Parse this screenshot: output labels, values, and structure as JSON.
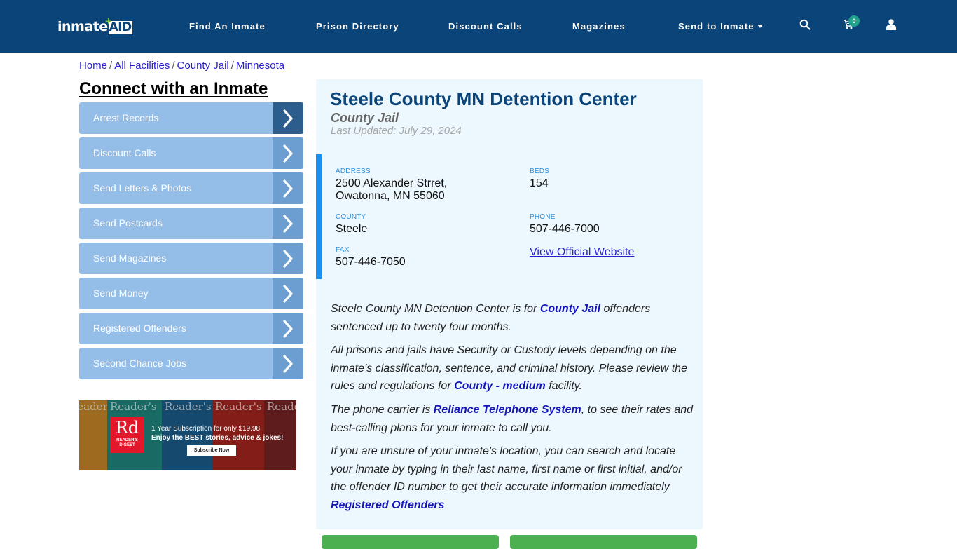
{
  "header": {
    "logo": {
      "text": "inmate",
      "accent": "AID",
      "plus": "+"
    },
    "nav": [
      {
        "label": "Find An Inmate"
      },
      {
        "label": "Prison Directory"
      },
      {
        "label": "Discount Calls"
      },
      {
        "label": "Magazines"
      },
      {
        "label": "Send to Inmate",
        "has_dropdown": true
      }
    ],
    "icons": {
      "search": "search-icon",
      "cart": "cart-icon",
      "user": "user-icon"
    },
    "cart_count": "0",
    "colors": {
      "bar": "#0b4478",
      "badge": "#1fa38a"
    }
  },
  "breadcrumb": {
    "items": [
      "Home",
      "All Facilities",
      "County Jail",
      "Minnesota"
    ],
    "separator": "/"
  },
  "sidebar": {
    "title": "Connect with an Inmate",
    "items": [
      {
        "label": "Arrest Records",
        "active": true
      },
      {
        "label": "Discount Calls"
      },
      {
        "label": "Send Letters & Photos"
      },
      {
        "label": "Send Postcards"
      },
      {
        "label": "Send Magazines"
      },
      {
        "label": "Send Money"
      },
      {
        "label": "Registered Offenders"
      },
      {
        "label": "Second Chance Jobs"
      }
    ],
    "ad": {
      "brand_big": "Rd",
      "brand_small_1": "READER'S",
      "brand_small_2": "DIGEST",
      "masthead": "Reader's",
      "line1": "1 Year Subscription for only $19.98",
      "line2": "Enjoy the BEST stories, advice & jokes!",
      "button": "Subscribe Now"
    }
  },
  "facility": {
    "title": "Steele County MN Detention Center",
    "type": "County Jail",
    "last_updated": "Last Updated: July 29, 2024",
    "info": {
      "address_label": "ADDRESS",
      "address_line1": "2500 Alexander Strret,",
      "address_line2": "Owatonna, MN 55060",
      "beds_label": "BEDS",
      "beds": "154",
      "county_label": "COUNTY",
      "county": "Steele",
      "phone_label": "PHONE",
      "phone": "507-446-7000",
      "fax_label": "FAX",
      "fax": "507-446-7050",
      "website_link": "View Official Website"
    },
    "paragraphs": {
      "p1_a": "Steele County MN Detention Center is for ",
      "p1_link": "County Jail",
      "p1_b": " offenders sentenced up to twenty four months.",
      "p2_a": "All prisons and jails have Security or Custody levels depending on the inmate’s classification, sentence, and criminal history. Please review the rules and regulations for ",
      "p2_link": "County - medium",
      "p2_b": " facility.",
      "p3_a": "The phone carrier is ",
      "p3_link": "Reliance Telephone System",
      "p3_b": ", to see their rates and best-calling plans for your inmate to call you.",
      "p4_a": "If you are unsure of your inmate's location, you can search and locate your inmate by typing in their last name, first name or first initial, and/or the offender ID number to get their accurate information immediately",
      "p4_link": "Registered Offenders"
    },
    "colors": {
      "title": "#0b4478",
      "panel_bg": "#ecf7fe",
      "accent_bar": "#1a8fee",
      "link": "#1414b8",
      "green_button": "#4caf50"
    }
  }
}
